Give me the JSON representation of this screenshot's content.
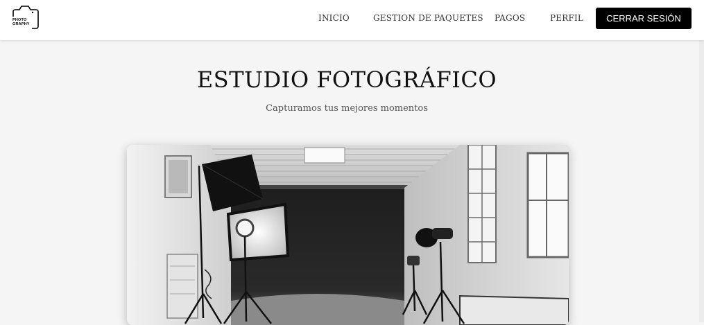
{
  "logo": {
    "line1": "PHOTO",
    "line2": "GRAPHY",
    "icon": "camera-icon"
  },
  "nav": {
    "items": [
      {
        "label": "INICIO"
      },
      {
        "label": "GESTION DE PAQUETES"
      },
      {
        "label": "PAGOS"
      },
      {
        "label": "PERFIL"
      }
    ],
    "logout_label": "CERRAR SESIÓN"
  },
  "hero": {
    "title": "ESTUDIO FOTOGRÁFICO",
    "subtitle": "Capturamos tus mejores momentos"
  },
  "image": {
    "alt": "Estudio fotográfico en blanco y negro con luces y fondo"
  },
  "colors": {
    "navbar_bg": "#ffffff",
    "page_bg": "#f5f5f5",
    "button_bg": "#000000",
    "button_text": "#ffffff"
  }
}
